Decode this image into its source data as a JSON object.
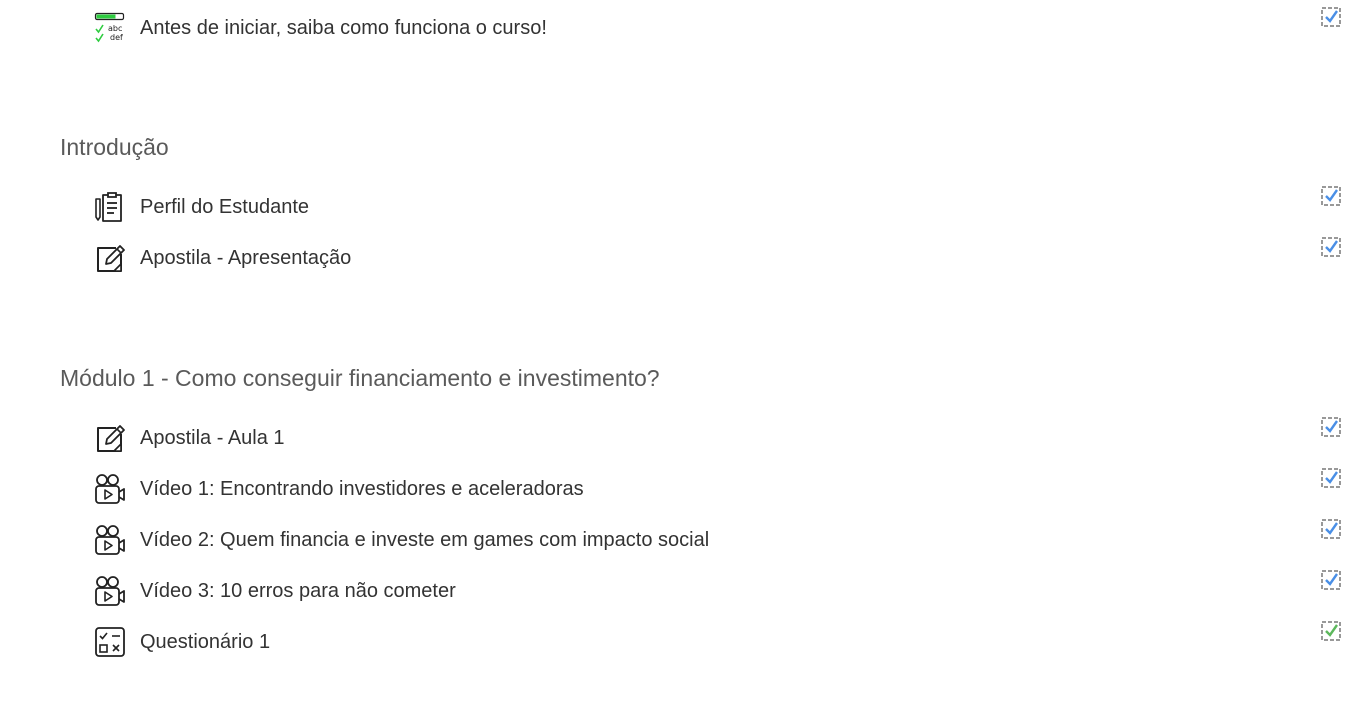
{
  "colors": {
    "check_manual": "#4a8fe6",
    "check_auto": "#5cb85c",
    "box_border": "#999999",
    "feedback_bar": "#2ecc40"
  },
  "top_activity": {
    "label": "Antes de iniciar, saiba como funciona o curso!",
    "icon": "feedback-icon",
    "icon_text_top": "abc",
    "icon_text_bottom": "def",
    "completion": "done-manual"
  },
  "sections": [
    {
      "title": "Introdução",
      "activities": [
        {
          "label": "Perfil do Estudante",
          "icon": "clipboard-pencil-icon",
          "completion": "done-manual"
        },
        {
          "label": "Apostila - Apresentação",
          "icon": "edit-icon",
          "completion": "done-manual"
        }
      ]
    },
    {
      "title": "Módulo 1 - Como conseguir financiamento e investimento?",
      "activities": [
        {
          "label": "Apostila - Aula 1",
          "icon": "edit-icon",
          "completion": "done-manual"
        },
        {
          "label": "Vídeo 1: Encontrando investidores e aceleradoras",
          "icon": "video-camera-icon",
          "completion": "done-manual"
        },
        {
          "label": "Vídeo 2: Quem financia e investe em games com impacto social",
          "icon": "video-camera-icon",
          "completion": "done-manual"
        },
        {
          "label": "Vídeo 3: 10 erros para não cometer",
          "icon": "video-camera-icon",
          "completion": "done-manual"
        },
        {
          "label": "Questionário 1",
          "icon": "quiz-icon",
          "completion": "done-auto"
        }
      ]
    }
  ]
}
